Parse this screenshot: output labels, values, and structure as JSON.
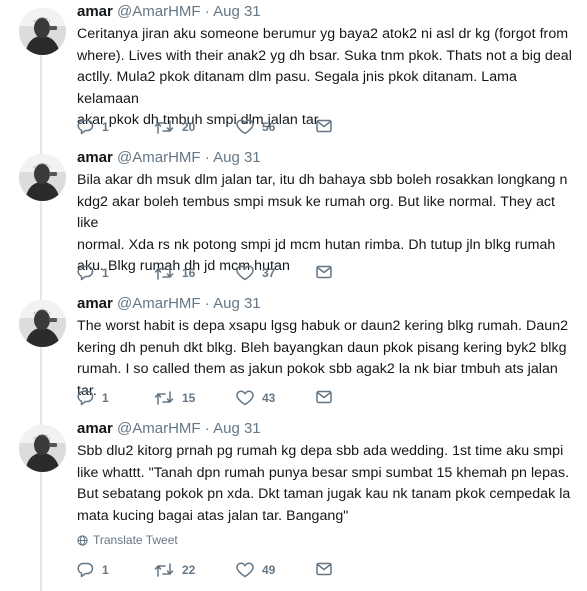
{
  "tweets": [
    {
      "name": "amar",
      "handle": "@AmarHMF",
      "separator": "·",
      "date": "Aug 31",
      "lines": [
        "Ceritanya jiran aku someone berumur yg baya2 atok2 ni asl dr kg (forgot from",
        "where). Lives with their anak2 yg dh bsar. Suka tnm pkok. Thats not a big deal",
        "actlly. Mula2 pkok ditanam dlm pasu. Segala jnis pkok ditanam. Lama kelamaan",
        "akar pkok dh tmbuh smpi dlm jalan tar"
      ],
      "replies": "1",
      "retweets": "20",
      "likes": "56"
    },
    {
      "name": "amar",
      "handle": "@AmarHMF",
      "separator": "·",
      "date": "Aug 31",
      "lines": [
        "Bila akar dh msuk dlm jalan tar, itu dh bahaya sbb boleh rosakkan longkang n",
        "kdg2 akar boleh tembus smpi msuk ke rumah org. But like normal. They act like",
        "normal. Xda rs nk potong smpi jd mcm hutan rimba. Dh tutup jln blkg rumah",
        "aku. Blkg rumah dh jd mcm hutan"
      ],
      "replies": "1",
      "retweets": "16",
      "likes": "37"
    },
    {
      "name": "amar",
      "handle": "@AmarHMF",
      "separator": "·",
      "date": "Aug 31",
      "lines": [
        "The worst habit is depa xsapu lgsg habuk or daun2 kering blkg rumah. Daun2",
        "kering dh penuh dkt blkg. Bleh bayangkan daun pkok pisang kering byk2 blkg",
        "rumah. I so called them as jakun pokok sbb agak2 la nk biar tmbuh ats jalan tar."
      ],
      "replies": "1",
      "retweets": "15",
      "likes": "43"
    },
    {
      "name": "amar",
      "handle": "@AmarHMF",
      "separator": "·",
      "date": "Aug 31",
      "lines": [
        "Sbb dlu2 kitorg prnah pg rumah kg depa sbb ada wedding. 1st time aku smpi",
        "like whattt. \"Tanah dpn rumah punya besar smpi sumbat 15 khemah pn lepas.",
        "But sebatang pokok pn xda. Dkt taman jugak kau nk tanam pkok cempedak la",
        "mata kucing bagai atas jalan tar. Bangang\""
      ],
      "translate_label": "Translate Tweet",
      "replies": "1",
      "retweets": "22",
      "likes": "49"
    }
  ],
  "icons": {
    "reply": "reply-icon",
    "retweet": "retweet-icon",
    "like": "like-icon",
    "dm": "direct-message-icon",
    "globe": "globe-icon"
  },
  "colors": {
    "text": "#14171a",
    "muted": "#657786",
    "divider": "#e6ecf0",
    "thread": "#e1e8ed"
  }
}
